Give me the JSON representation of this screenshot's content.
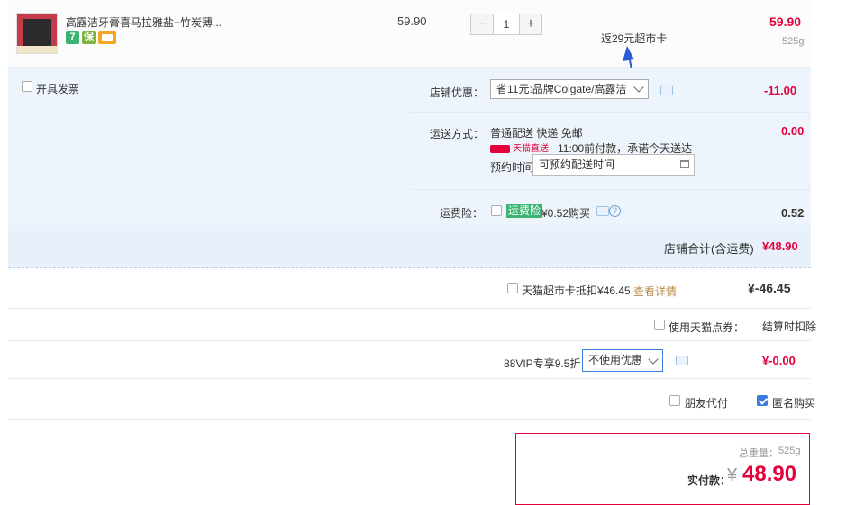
{
  "item": {
    "title": "高露洁牙膏喜马拉雅盐+竹炭薄...",
    "badges": [
      {
        "text": "7",
        "color": "#3cb371"
      },
      {
        "text": "保",
        "color": "#7cb342"
      },
      {
        "text": "",
        "color": "#f5a623"
      }
    ],
    "unit_price": "59.90",
    "quantity": "1",
    "minus": "−",
    "plus": "+",
    "subtotal": "59.90",
    "weight": "525g",
    "callout": "返29元超市卡"
  },
  "store": {
    "invoice_label": "开具发票",
    "discount_label": "店铺优惠：",
    "discount_select": "省11元:品牌Colgate/高露洁",
    "discount_amount": "-11.00",
    "shipping_label": "运送方式：",
    "shipping_method": "普通配送 快递 免邮",
    "tmall_tag": "天猫直送",
    "shipping_promise": "11:00前付款，承诺今天送达",
    "shipping_amount": "0.00",
    "appointment_label": "预约时间",
    "appointment_value": "可预约配送时间",
    "insurance_label": "运费险：",
    "insurance_tag": "运费险",
    "insurance_price": "¥0.52购买",
    "insurance_amount": "0.52",
    "total_label": "店铺合计(含运费)",
    "total_amount": "¥48.90"
  },
  "extras": {
    "card_label": "天猫超市卡抵扣¥46.45",
    "card_link": "查看详情",
    "card_amount": "¥-46.45",
    "points_label": "使用天猫点券：",
    "points_value": "结算时扣除",
    "vip_label": "88VIP专享9.5折",
    "vip_select": "不使用优惠",
    "vip_amount": "¥-0.00",
    "friend_pay_label": "朋友代付",
    "anonymous_label": "匿名购买",
    "anonymous_checked": true
  },
  "payment": {
    "total_weight_label": "总重量：",
    "total_weight": "525g",
    "pay_label": "实付款：",
    "currency": "¥",
    "pay_amount": "48.90"
  },
  "colors": {
    "accent_red": "#e4003a",
    "panel_blue": "#eef4fb",
    "checkbox_blue": "#3a7be0",
    "green": "#3cb371"
  }
}
